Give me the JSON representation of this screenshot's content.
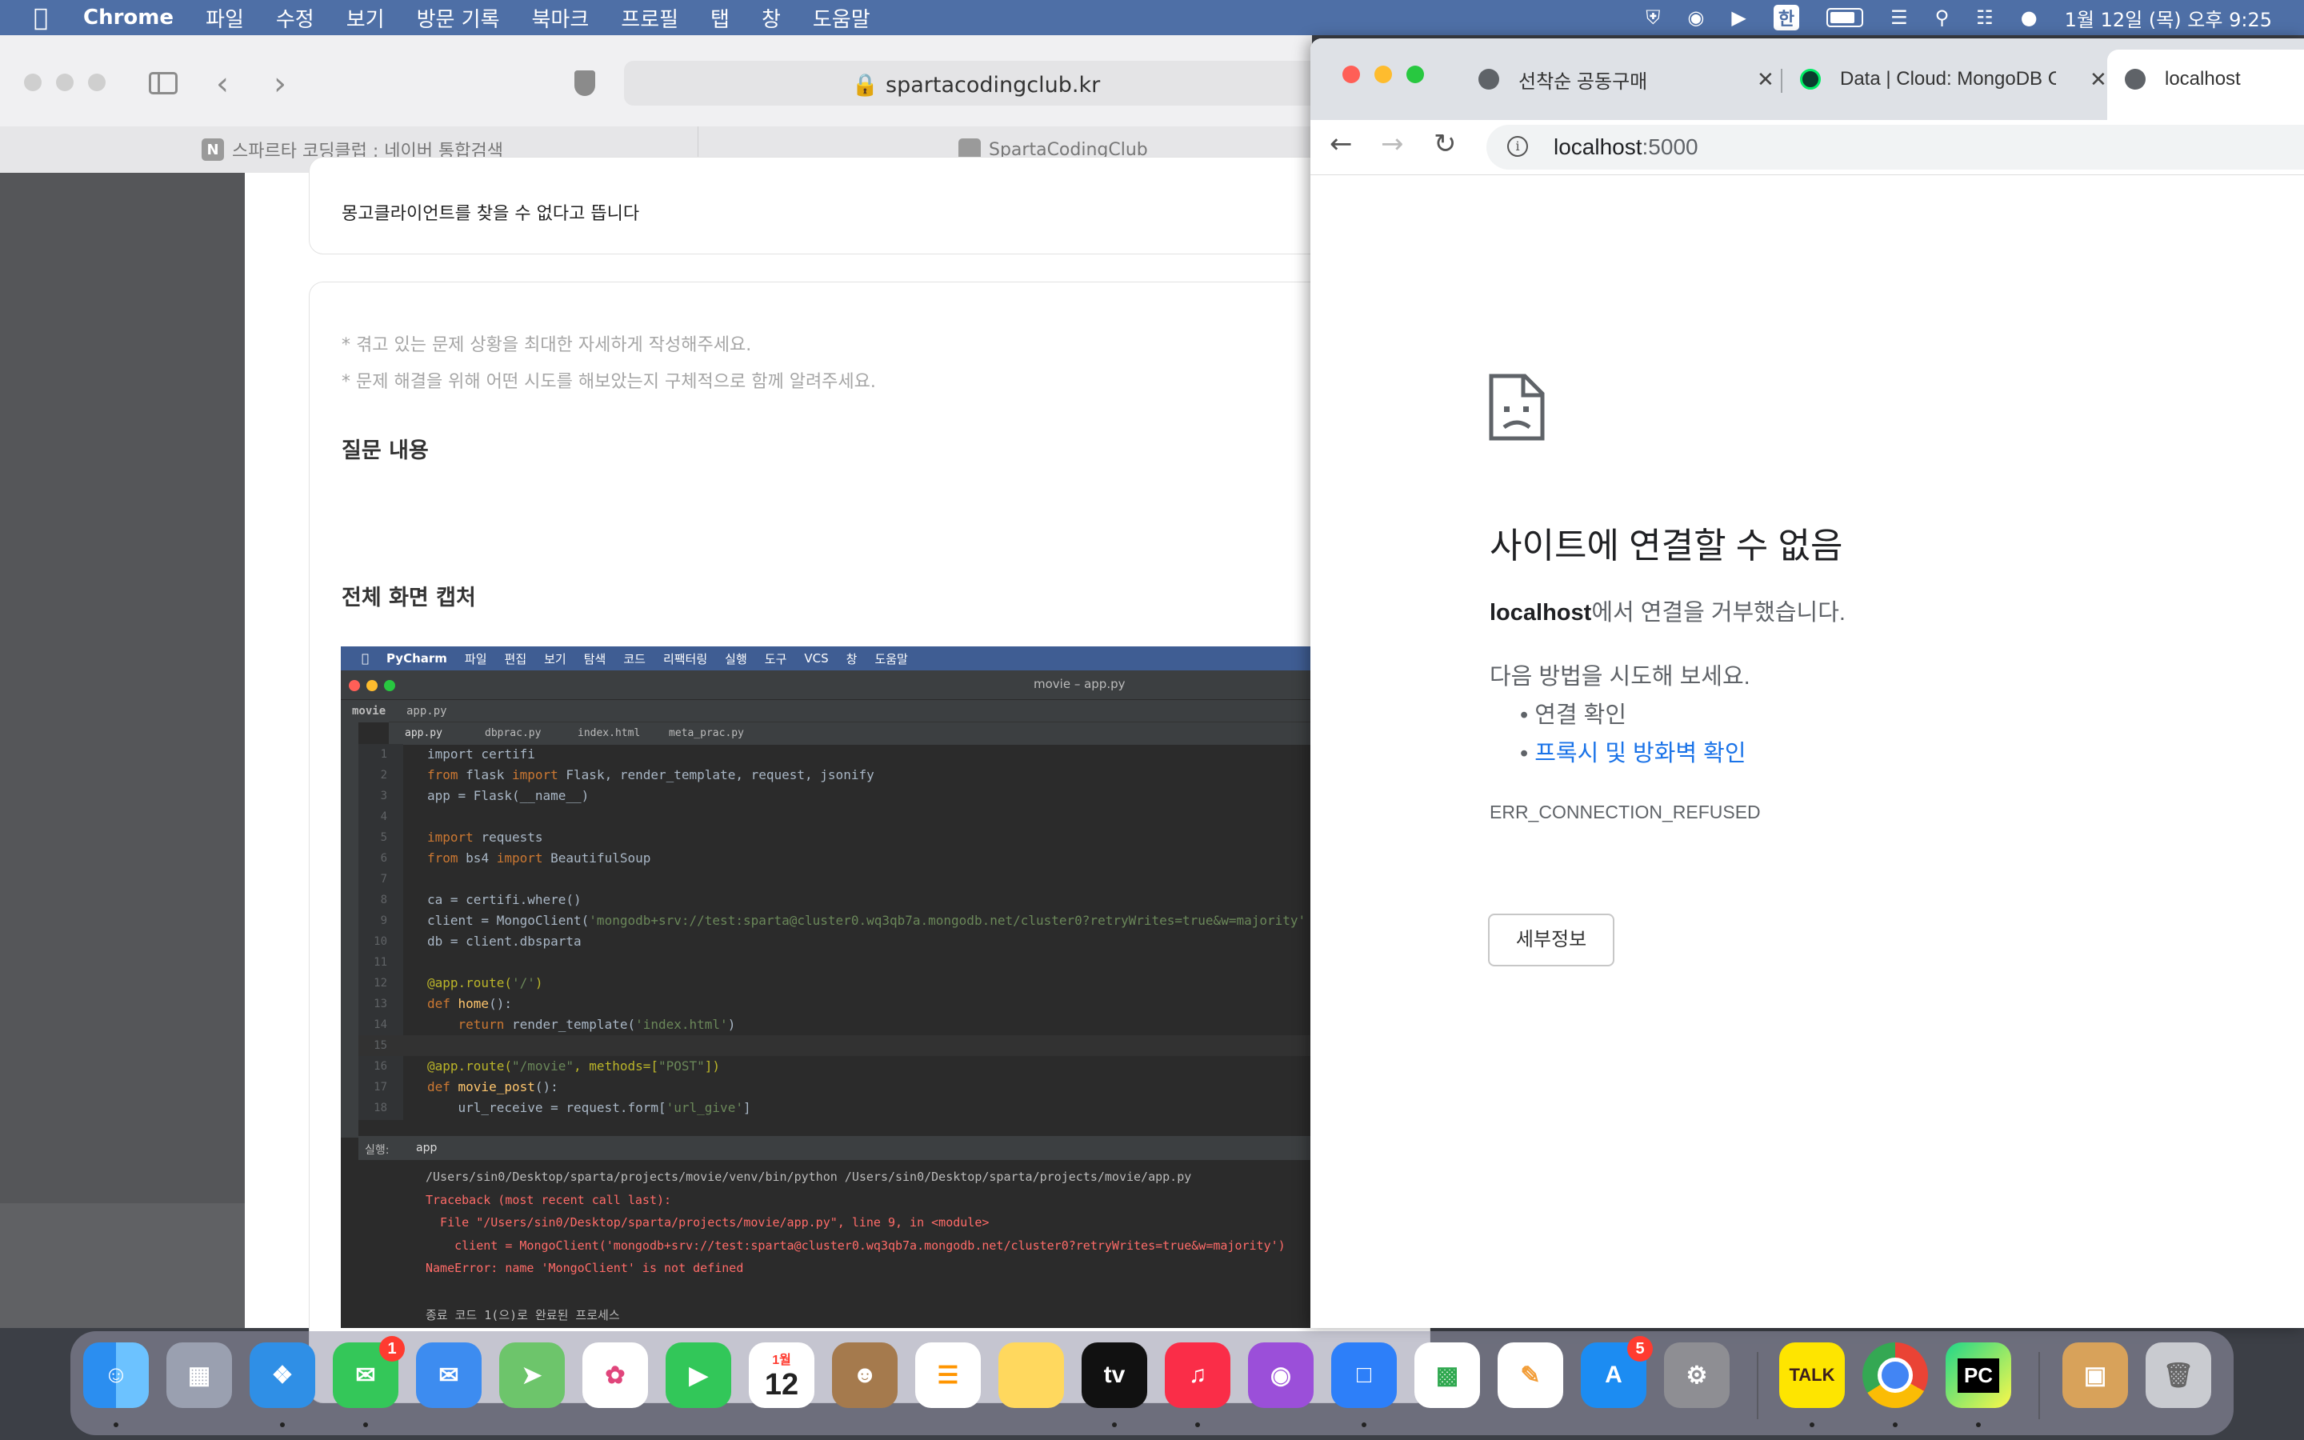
{
  "menubar": {
    "app": "Chrome",
    "items": [
      "파일",
      "수정",
      "보기",
      "방문 기록",
      "북마크",
      "프로필",
      "탭",
      "창",
      "도움말"
    ],
    "input_source": "한",
    "clock": "1월 12일 (목) 오후 9:25"
  },
  "safari": {
    "url": "spartacodingclub.kr",
    "tabs": [
      {
        "label": "스파르타 코딩클럽 : 네이버 통합검색",
        "favicon": "N"
      },
      {
        "label": "SpartaCodingClub"
      }
    ],
    "question_title": "몽고클라이언트를 찾을 수 없다고 뜹니다",
    "hints": [
      "* 겪고 있는 문제 상황을 최대한 자세하게 작성해주세요.",
      "* 문제 해결을 위해 어떤 시도를 해보았는지 구체적으로 함께 알려주세요."
    ],
    "section_question": "질문 내용",
    "section_capture": "전체 화면 캡처"
  },
  "pycharm": {
    "menu": [
      "PyCharm",
      "파일",
      "편집",
      "보기",
      "탐색",
      "코드",
      "리팩터링",
      "실행",
      "도구",
      "VCS",
      "창",
      "도움말"
    ],
    "window_title": "movie – app.py",
    "breadcrumb_project": "movie",
    "breadcrumb_file": "app.py",
    "tabs": [
      "app.py",
      "dbprac.py",
      "index.html",
      "meta_prac.py"
    ],
    "lines": [
      {
        "n": "1",
        "segs": [
          {
            "t": "import certifi",
            "c": ""
          }
        ]
      },
      {
        "n": "2",
        "segs": [
          {
            "t": "from ",
            "c": "kw"
          },
          {
            "t": "flask ",
            "c": ""
          },
          {
            "t": "import ",
            "c": "kw"
          },
          {
            "t": "Flask, render_template, request, jsonify",
            "c": ""
          }
        ]
      },
      {
        "n": "3",
        "segs": [
          {
            "t": "app = Flask(__name__)",
            "c": ""
          }
        ]
      },
      {
        "n": "4",
        "segs": []
      },
      {
        "n": "5",
        "segs": [
          {
            "t": "import ",
            "c": "kw"
          },
          {
            "t": "requests",
            "c": ""
          }
        ]
      },
      {
        "n": "6",
        "segs": [
          {
            "t": "from ",
            "c": "kw"
          },
          {
            "t": "bs4 ",
            "c": ""
          },
          {
            "t": "import ",
            "c": "kw"
          },
          {
            "t": "BeautifulSoup",
            "c": ""
          }
        ]
      },
      {
        "n": "7",
        "segs": []
      },
      {
        "n": "8",
        "segs": [
          {
            "t": "ca = certifi.where()",
            "c": ""
          }
        ]
      },
      {
        "n": "9",
        "segs": [
          {
            "t": "client = MongoClient(",
            "c": ""
          },
          {
            "t": "'mongodb+srv://test:sparta@cluster0.wq3qb7a.mongodb.net/cluster0?retryWrites=true&w=majority'",
            "c": "str"
          }
        ]
      },
      {
        "n": "10",
        "segs": [
          {
            "t": "db = client.dbsparta",
            "c": ""
          }
        ]
      },
      {
        "n": "11",
        "segs": []
      },
      {
        "n": "12",
        "segs": [
          {
            "t": "@app.route(",
            "c": "dec"
          },
          {
            "t": "'/'",
            "c": "str"
          },
          {
            "t": ")",
            "c": "dec"
          }
        ]
      },
      {
        "n": "13",
        "segs": [
          {
            "t": "def ",
            "c": "kw"
          },
          {
            "t": "home",
            "c": "fn"
          },
          {
            "t": "():",
            "c": ""
          }
        ]
      },
      {
        "n": "14",
        "segs": [
          {
            "t": "    return ",
            "c": "kw"
          },
          {
            "t": "render_template(",
            "c": ""
          },
          {
            "t": "'index.html'",
            "c": "str"
          },
          {
            "t": ")",
            "c": ""
          }
        ]
      },
      {
        "n": "15",
        "segs": []
      },
      {
        "n": "16",
        "segs": [
          {
            "t": "@app.route(",
            "c": "dec"
          },
          {
            "t": "\"/movie\"",
            "c": "str"
          },
          {
            "t": ", methods=[",
            "c": "dec"
          },
          {
            "t": "\"POST\"",
            "c": "str"
          },
          {
            "t": "])",
            "c": "dec"
          }
        ]
      },
      {
        "n": "17",
        "segs": [
          {
            "t": "def ",
            "c": "kw"
          },
          {
            "t": "movie_post",
            "c": "fn"
          },
          {
            "t": "():",
            "c": ""
          }
        ]
      },
      {
        "n": "18",
        "segs": [
          {
            "t": "    url_receive = request.form[",
            "c": ""
          },
          {
            "t": "'url_give'",
            "c": "str"
          },
          {
            "t": "]",
            "c": ""
          }
        ]
      }
    ],
    "run_label": "실행:",
    "run_tab": "app",
    "output": [
      {
        "t": "/Users/sin0/Desktop/sparta/projects/movie/venv/bin/python /Users/sin0/Desktop/sparta/projects/movie/app.py",
        "color": "#bbbbbb"
      },
      {
        "t": "Traceback (most recent call last):",
        "color": "#ff6b68"
      },
      {
        "t": "  File \"/Users/sin0/Desktop/sparta/projects/movie/app.py\", line 9, in <module>",
        "color": "#ff6b68"
      },
      {
        "t": "    client = MongoClient('mongodb+srv://test:sparta@cluster0.wq3qb7a.mongodb.net/cluster0?retryWrites=true&w=majority')",
        "color": "#ff6b68"
      },
      {
        "t": "NameError: name 'MongoClient' is not defined",
        "color": "#ff6b68"
      },
      {
        "t": "",
        "color": "#bbbbbb"
      },
      {
        "t": "종료 코드 1(으)로 완료된 프로세스",
        "color": "#bbbbbb"
      }
    ]
  },
  "chrome": {
    "tabs": [
      {
        "label": "선착순 공동구매",
        "favicon": "globe-icon"
      },
      {
        "label": "Data | Cloud: MongoDB Cl",
        "favicon": "mongodb-leaf-icon"
      },
      {
        "label": "localhost",
        "favicon": "globe-icon"
      }
    ],
    "url_host": "localhost",
    "url_port": ":5000",
    "error": {
      "heading": "사이트에 연결할 수 없음",
      "host_bold": "localhost",
      "refused_suffix": "에서 연결을 거부했습니다.",
      "try_heading": "다음 방법을 시도해 보세요.",
      "suggestions": [
        "연결 확인",
        "프록시 및 방화벽 확인"
      ],
      "code": "ERR_CONNECTION_REFUSED",
      "details_button": "세부정보"
    },
    "link_color": "#1a73e8"
  },
  "dock": {
    "calendar_month": "1월",
    "calendar_day": "12",
    "messages_badge": "1",
    "appstore_badge": "5",
    "kakaotalk_label": "TALK",
    "pycharm_label": "PC",
    "appletv_label": "tv"
  }
}
